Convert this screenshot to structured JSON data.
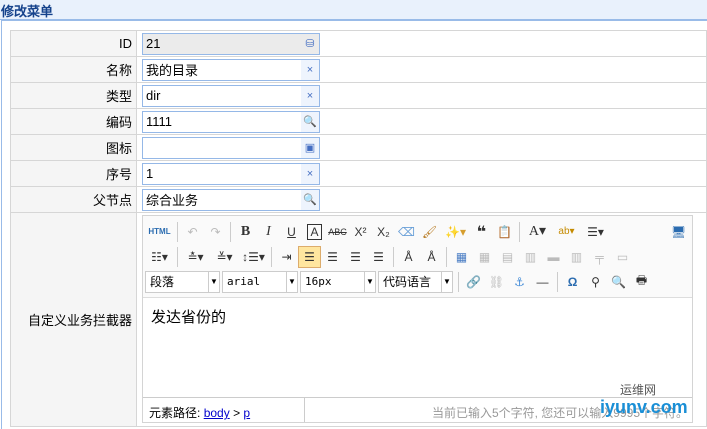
{
  "title": "修改菜单",
  "fields": [
    {
      "label": "ID",
      "value": "21",
      "icon": "database-add-icon",
      "sym": "⛁"
    },
    {
      "label": "名称",
      "value": "我的目录",
      "icon": "clear-icon",
      "sym": "×"
    },
    {
      "label": "类型",
      "value": "dir",
      "icon": "clear-icon",
      "sym": "×"
    },
    {
      "label": "编码",
      "value": "1111",
      "icon": "search-icon",
      "sym": "🔍"
    },
    {
      "label": "图标",
      "value": "",
      "icon": "icon-picker-icon",
      "sym": "▣"
    },
    {
      "label": "序号",
      "value": "1",
      "icon": "clear-icon",
      "sym": "×"
    },
    {
      "label": "父节点",
      "value": "综合业务",
      "icon": "search-icon",
      "sym": "🔍"
    }
  ],
  "editor": {
    "label": "自定义业务拦截器",
    "html_label": "HTML",
    "paragraph": "段落",
    "font": "arial",
    "size": "16px",
    "code": "代码语言",
    "content": "发达省份的",
    "path_label": "元素路径:",
    "path_body": "body",
    "path_sep": ">",
    "path_p": "p",
    "count_text": "当前已输入5个字符, 您还可以输入9995个字符。"
  },
  "watermark": {
    "cn": "运维网",
    "en": "iyunv.com"
  }
}
